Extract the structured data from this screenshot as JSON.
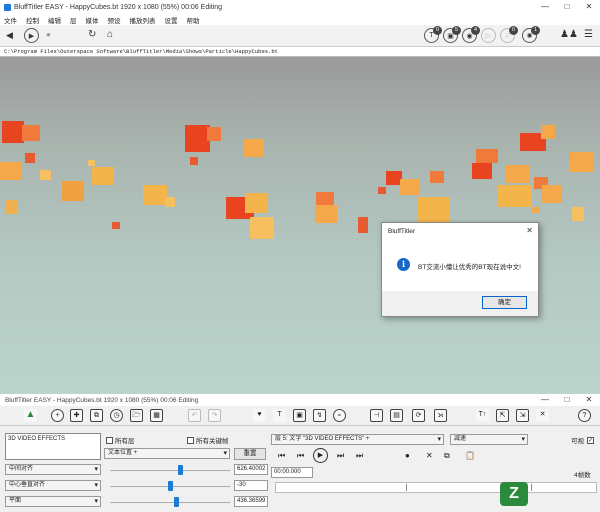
{
  "window": {
    "title": "BluffTitler EASY - HappyCubes.bt 1920 x 1080 (55%) 00:06 Editing"
  },
  "menu": [
    "文件",
    "控制",
    "编辑",
    "层",
    "媒体",
    "预设",
    "播放列表",
    "设置",
    "帮助"
  ],
  "toolbar": {
    "badges": [
      "0",
      "5",
      "4",
      "0",
      "1"
    ]
  },
  "path": "C:\\Program Files\\Outerspace Software\\BluffTitler\\Media\\Shows\\Particle\\HappyCubes.bt",
  "dialog": {
    "title": "BluffTitler",
    "message": "BT交流小懂让优秀的BT现在说中文!",
    "ok": "确定"
  },
  "panel": {
    "title": "BluffTitler EASY - HappyCubes.bt 1920 x 1080 (55%) 00:06 Editing",
    "text_value": "3D VIDEO EFFECTS",
    "check_all_layers": "所有层",
    "check_all_keys": "所有关键帧",
    "layer_select": "层 5: 文字 \"3D VIDEO EFFECTS\" +",
    "easing_select": "减速",
    "visible_label": "可视",
    "property_select": "文本位置 +",
    "reset": "重置",
    "align_h": "中间对齐",
    "align_v": "中心垂直对齐",
    "plane": "平面",
    "value1": "626.40002",
    "value2": "-30",
    "value3": "436.36599",
    "time": "00:00.000",
    "frames": "4帧数",
    "slider1_level": 0.58,
    "slider2_level": 0.5,
    "slider3_level": 0.55
  },
  "watermark": "Z"
}
